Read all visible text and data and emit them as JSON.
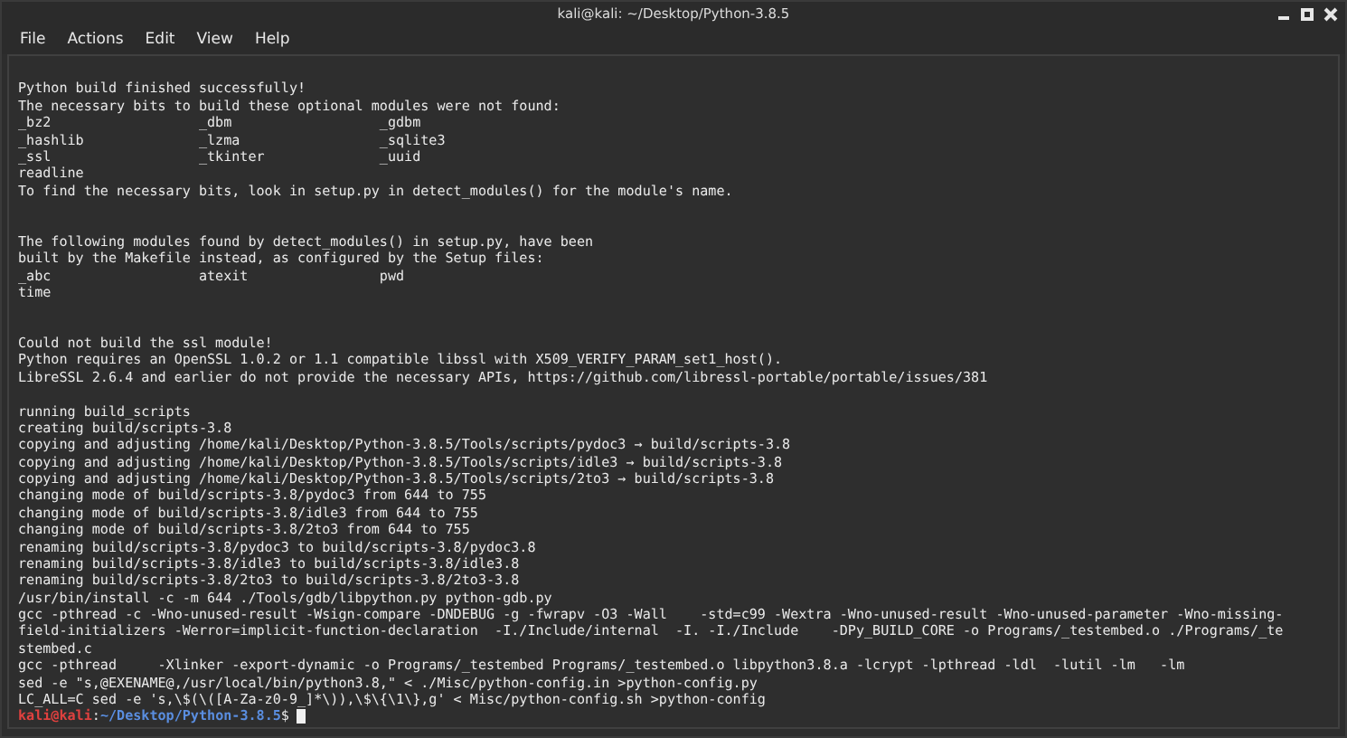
{
  "window": {
    "title": "kali@kali: ~/Desktop/Python-3.8.5"
  },
  "menu": [
    "File",
    "Actions",
    "Edit",
    "View",
    "Help"
  ],
  "terminal": {
    "lines": [
      {
        "kind": "blank"
      },
      {
        "kind": "text",
        "text": "Python build finished successfully!"
      },
      {
        "kind": "text",
        "text": "The necessary bits to build these optional modules were not found:"
      },
      {
        "kind": "text",
        "text": "_bz2                  _dbm                  _gdbm"
      },
      {
        "kind": "text",
        "text": "_hashlib              _lzma                 _sqlite3"
      },
      {
        "kind": "text",
        "text": "_ssl                  _tkinter              _uuid"
      },
      {
        "kind": "text",
        "text": "readline"
      },
      {
        "kind": "text",
        "text": "To find the necessary bits, look in setup.py in detect_modules() for the module's name."
      },
      {
        "kind": "blank"
      },
      {
        "kind": "blank"
      },
      {
        "kind": "text",
        "text": "The following modules found by detect_modules() in setup.py, have been"
      },
      {
        "kind": "text",
        "text": "built by the Makefile instead, as configured by the Setup files:"
      },
      {
        "kind": "text",
        "text": "_abc                  atexit                pwd"
      },
      {
        "kind": "text",
        "text": "time"
      },
      {
        "kind": "blank"
      },
      {
        "kind": "blank"
      },
      {
        "kind": "text",
        "text": "Could not build the ssl module!"
      },
      {
        "kind": "text",
        "text": "Python requires an OpenSSL 1.0.2 or 1.1 compatible libssl with X509_VERIFY_PARAM_set1_host()."
      },
      {
        "kind": "text",
        "text": "LibreSSL 2.6.4 and earlier do not provide the necessary APIs, https://github.com/libressl-portable/portable/issues/381"
      },
      {
        "kind": "blank"
      },
      {
        "kind": "text",
        "text": "running build_scripts"
      },
      {
        "kind": "text",
        "text": "creating build/scripts-3.8"
      },
      {
        "kind": "text",
        "text": "copying and adjusting /home/kali/Desktop/Python-3.8.5/Tools/scripts/pydoc3 → build/scripts-3.8"
      },
      {
        "kind": "text",
        "text": "copying and adjusting /home/kali/Desktop/Python-3.8.5/Tools/scripts/idle3 → build/scripts-3.8"
      },
      {
        "kind": "text",
        "text": "copying and adjusting /home/kali/Desktop/Python-3.8.5/Tools/scripts/2to3 → build/scripts-3.8"
      },
      {
        "kind": "text",
        "text": "changing mode of build/scripts-3.8/pydoc3 from 644 to 755"
      },
      {
        "kind": "text",
        "text": "changing mode of build/scripts-3.8/idle3 from 644 to 755"
      },
      {
        "kind": "text",
        "text": "changing mode of build/scripts-3.8/2to3 from 644 to 755"
      },
      {
        "kind": "text",
        "text": "renaming build/scripts-3.8/pydoc3 to build/scripts-3.8/pydoc3.8"
      },
      {
        "kind": "text",
        "text": "renaming build/scripts-3.8/idle3 to build/scripts-3.8/idle3.8"
      },
      {
        "kind": "text",
        "text": "renaming build/scripts-3.8/2to3 to build/scripts-3.8/2to3-3.8"
      },
      {
        "kind": "text",
        "text": "/usr/bin/install -c -m 644 ./Tools/gdb/libpython.py python-gdb.py"
      },
      {
        "kind": "text",
        "text": "gcc -pthread -c -Wno-unused-result -Wsign-compare -DNDEBUG -g -fwrapv -O3 -Wall    -std=c99 -Wextra -Wno-unused-result -Wno-unused-parameter -Wno-missing-"
      },
      {
        "kind": "text",
        "text": "field-initializers -Werror=implicit-function-declaration  -I./Include/internal  -I. -I./Include    -DPy_BUILD_CORE -o Programs/_testembed.o ./Programs/_te"
      },
      {
        "kind": "text",
        "text": "stembed.c"
      },
      {
        "kind": "text",
        "text": "gcc -pthread     -Xlinker -export-dynamic -o Programs/_testembed Programs/_testembed.o libpython3.8.a -lcrypt -lpthread -ldl  -lutil -lm   -lm"
      },
      {
        "kind": "text",
        "text": "sed -e \"s,@EXENAME@,/usr/local/bin/python3.8,\" < ./Misc/python-config.in >python-config.py"
      },
      {
        "kind": "text",
        "text": "LC_ALL=C sed -e 's,\\$(\\([A-Za-z0-9_]*\\)),\\$\\{\\1\\},g' < Misc/python-config.sh >python-config"
      }
    ],
    "prompt": {
      "user": "kali@kali",
      "separator": ":",
      "path": "~/Desktop/Python-3.8.5",
      "symbol": "$"
    }
  }
}
